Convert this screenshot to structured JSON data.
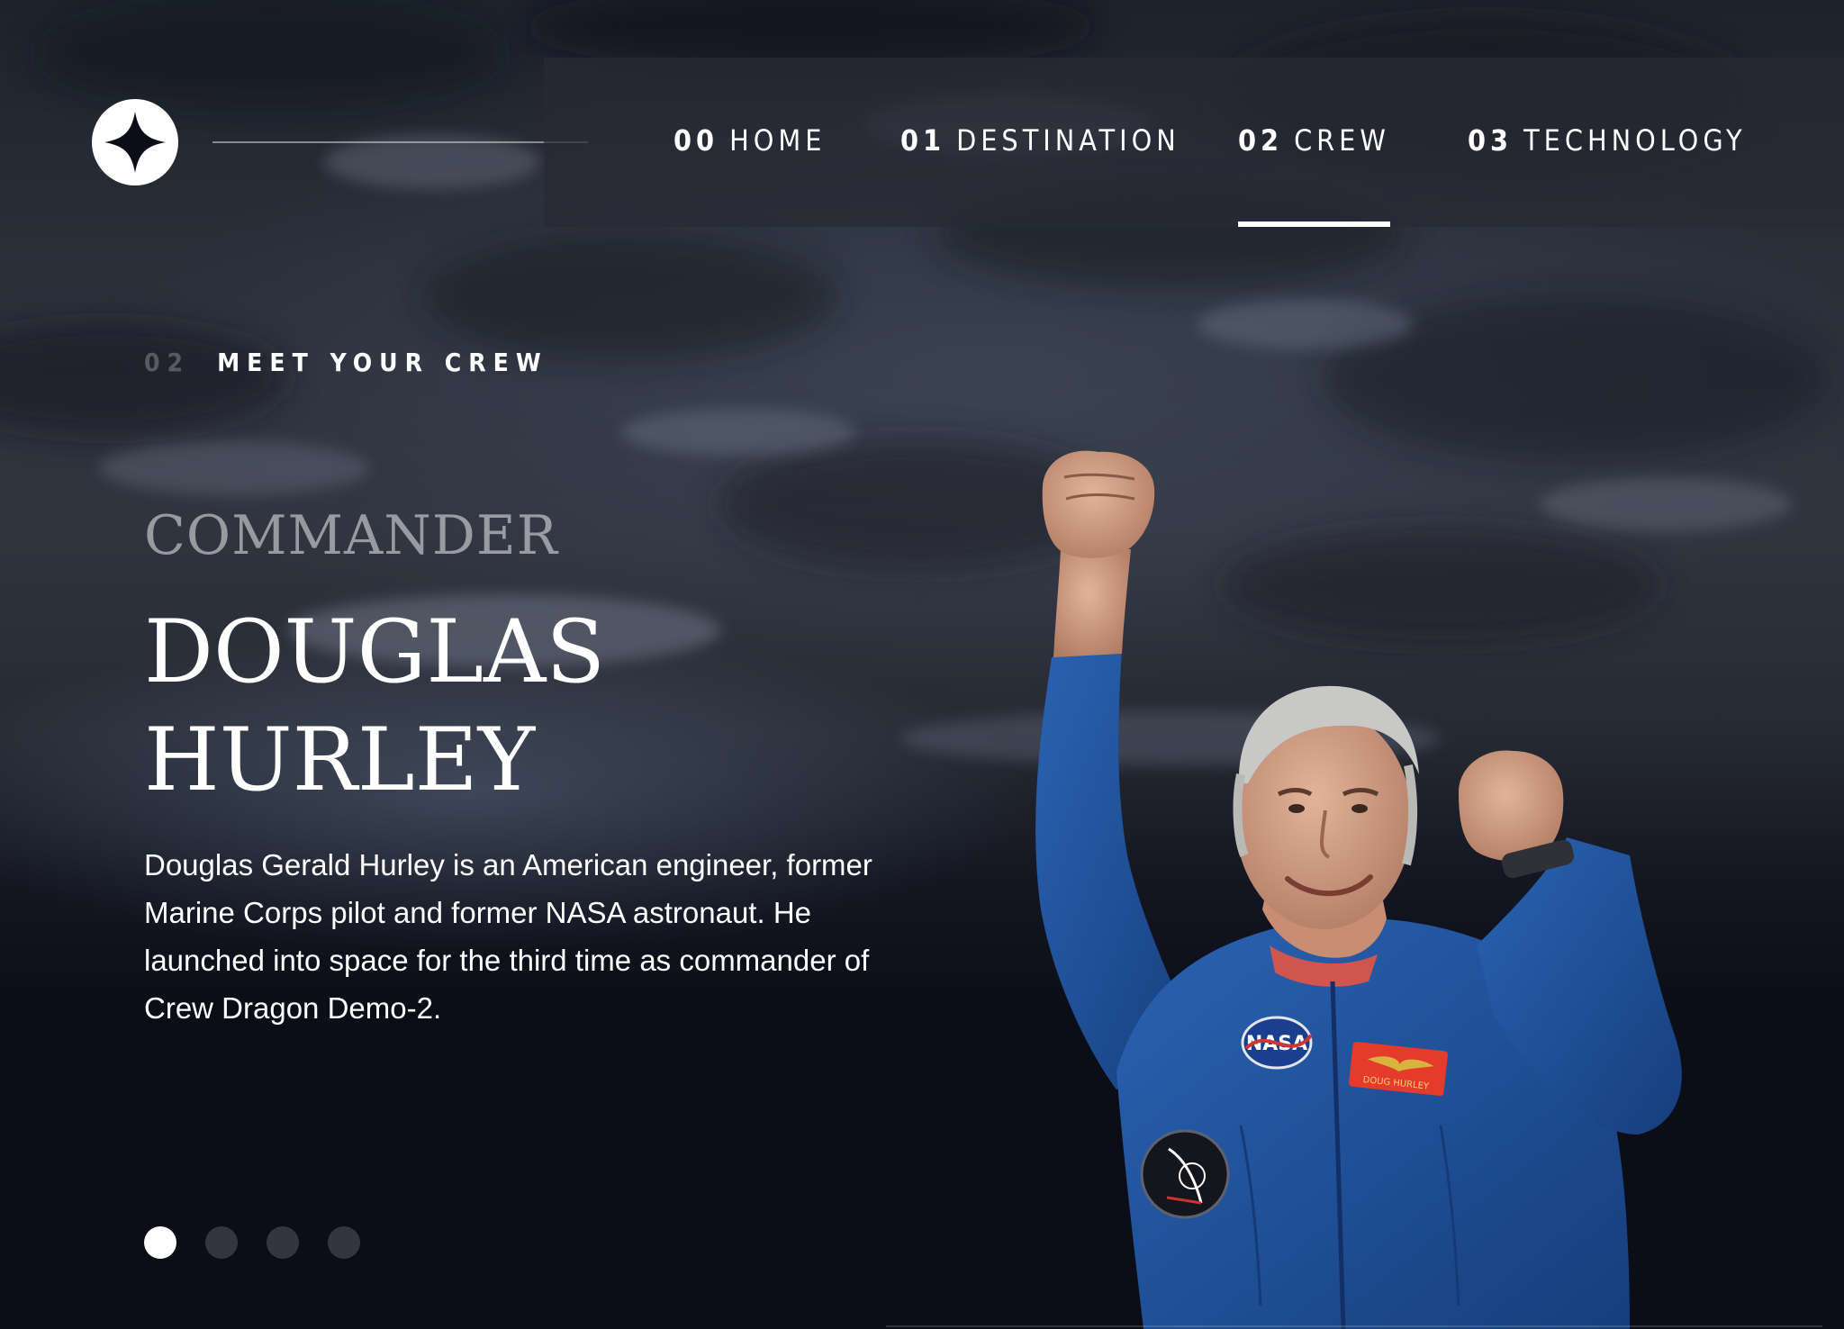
{
  "nav": {
    "items": [
      {
        "num": "00",
        "label": "HOME",
        "active": false
      },
      {
        "num": "01",
        "label": "DESTINATION",
        "active": false
      },
      {
        "num": "02",
        "label": "CREW",
        "active": true
      },
      {
        "num": "03",
        "label": "TECHNOLOGY",
        "active": false
      }
    ]
  },
  "section": {
    "num": "02",
    "title": "MEET YOUR CREW"
  },
  "crew": {
    "role": "COMMANDER",
    "name_line1": "DOUGLAS",
    "name_line2": "HURLEY",
    "bio": "Douglas Gerald Hurley is an American engineer, former Marine Corps pilot and former NASA astronaut. He launched into space for the third time as commander of Crew Dragon Demo-2.",
    "badge_name": "DOUG HURLEY",
    "patch_text": "NASA"
  },
  "pagination": {
    "count": 4,
    "active_index": 0
  },
  "icons": {
    "logo": "four-point-star-logo-icon"
  },
  "colors": {
    "background": "#0b0d17",
    "text": "#ffffff",
    "muted_text": "#ffffff80",
    "flight_suit": "#1e4f97"
  }
}
